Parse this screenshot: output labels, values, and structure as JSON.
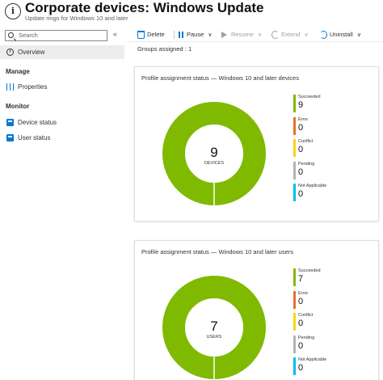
{
  "header": {
    "title": "Corporate devices: Windows Update",
    "subtitle": "Update rings for Windows 10 and later",
    "more": "···"
  },
  "sidebar": {
    "search_placeholder": "Search",
    "collapse": "«",
    "overview": "Overview",
    "manage_label": "Manage",
    "properties": "Properties",
    "monitor_label": "Monitor",
    "device_status": "Device status",
    "user_status": "User status"
  },
  "toolbar": {
    "delete": "Delete",
    "pause": "Pause",
    "resume": "Resume",
    "extend": "Extend",
    "uninstall": "Uninstall",
    "caret": "∨"
  },
  "groups_assigned": "Groups assigned  :  1",
  "colors": {
    "succeeded": "#7fba00",
    "error": "#e8702a",
    "conflict": "#fcd116",
    "pending": "#b3b3b3",
    "not_applicable": "#00bcf2",
    "accent": "#0078d4"
  },
  "cards": [
    {
      "title": "Profile assignment status — Windows 10 and later devices",
      "total": "9",
      "unit": "DEVICES",
      "legend": [
        {
          "name": "Succeeded",
          "value": "9",
          "color": "#7fba00"
        },
        {
          "name": "Error",
          "value": "0",
          "color": "#e8702a"
        },
        {
          "name": "Conflict",
          "value": "0",
          "color": "#fcd116"
        },
        {
          "name": "Pending",
          "value": "0",
          "color": "#b3b3b3"
        },
        {
          "name": "Not Applicable",
          "value": "0",
          "color": "#00bcf2"
        }
      ]
    },
    {
      "title": "Profile assignment status — Windows 10 and later users",
      "total": "7",
      "unit": "USERS",
      "legend": [
        {
          "name": "Succeeded",
          "value": "7",
          "color": "#7fba00"
        },
        {
          "name": "Error",
          "value": "0",
          "color": "#e8702a"
        },
        {
          "name": "Conflict",
          "value": "0",
          "color": "#fcd116"
        },
        {
          "name": "Pending",
          "value": "0",
          "color": "#b3b3b3"
        },
        {
          "name": "Not Applicable",
          "value": "0",
          "color": "#00bcf2"
        }
      ]
    }
  ]
}
